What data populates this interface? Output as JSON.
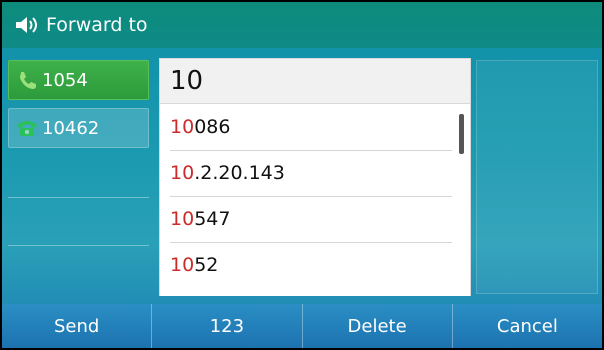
{
  "header": {
    "title": "Forward to",
    "icon": "speaker-icon"
  },
  "lines": [
    {
      "label": "1054",
      "icon": "handset-icon",
      "active": true,
      "color": "#3fb24a"
    },
    {
      "label": "10462",
      "icon": "desk-phone-icon",
      "active": false,
      "color": "#2aa84a"
    }
  ],
  "entry": {
    "value": "10"
  },
  "suggestions": [
    {
      "match": "10",
      "rest": "086"
    },
    {
      "match": "10",
      "rest": ".2.20.143"
    },
    {
      "match": "10",
      "rest": "547"
    },
    {
      "match": "10",
      "rest": "52"
    }
  ],
  "softkeys": [
    "Send",
    "123",
    "Delete",
    "Cancel"
  ],
  "colors": {
    "match": "#cc2b2b",
    "softkey_bar": "#1d72b0",
    "header": "#0d8c7c"
  }
}
